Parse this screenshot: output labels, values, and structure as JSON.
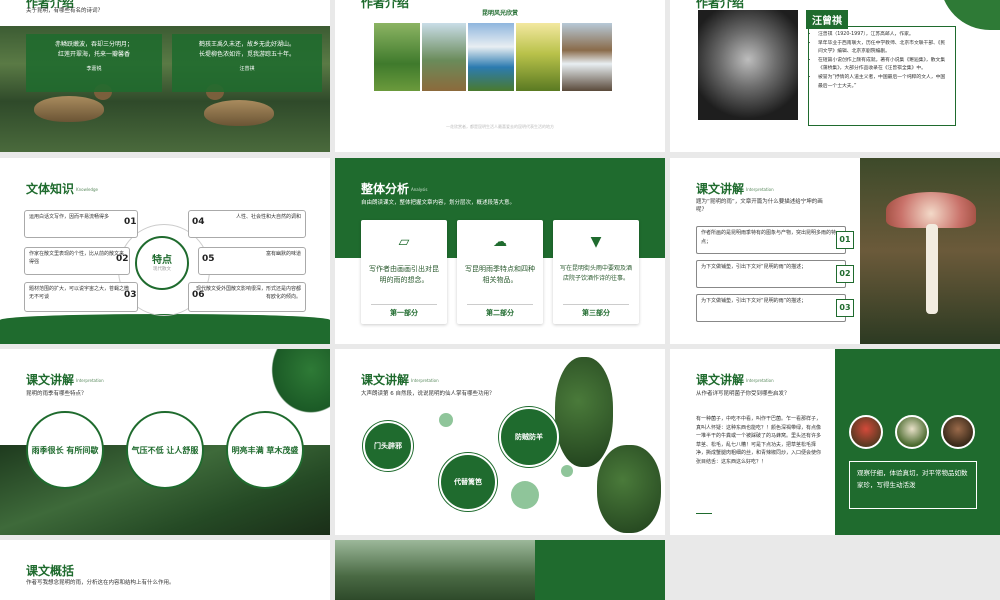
{
  "slide1": {
    "title": "作者介绍",
    "subtitle": "关于昆明，有哪些有名的诗词？",
    "quote_left": {
      "line1": "赤鳞跃嫩波，吞却三分明月；",
      "line2": "红莲开翠海，托来一瓣馨香",
      "author": "李嘉锐"
    },
    "quote_right": {
      "line1": "鹤孩王禹久未还，故乡无此好湖山。",
      "line2": "长堤柳色浓如许，觅我游踪五十年。",
      "author": "汪曾祺"
    }
  },
  "slide2": {
    "title": "作者介绍",
    "gallery_title": "昆明风光欣赏",
    "caption": "一花欣赏者，都是昆明生活人最喜爱去的昆明代表生活的地方"
  },
  "slide3": {
    "title": "作者介绍",
    "name": "汪曾祺",
    "bio": [
      "汪曾祺（1920-1997），江苏高邮人，作家。",
      "早年毕业于西南联大，历任中学教师、北京市文联干部、《民间文学》编辑、北京京剧院编剧。",
      "在短篇小说创作上颇有成就。著有小说集《邂逅集》，散文集《蒲桥集》，大部分作品收录在《汪曾祺全集》中。",
      "被誉为“抒情的人道主义者，中国最后一个纯粹的文人，中国最后一个士大夫。”"
    ]
  },
  "slide4": {
    "title": "文体知识",
    "title_en": "Knowledge",
    "center_label": "特点",
    "center_sub": "现代散文",
    "items": [
      {
        "num": "01",
        "text": "运用白话文写作，因而平易流畅得多"
      },
      {
        "num": "02",
        "text": "作家在散文里表现的个性，比从前的散文来得强"
      },
      {
        "num": "03",
        "text": "题材范围的扩大，可以说宇宙之大，苍蝇之微无不可谈"
      },
      {
        "num": "04",
        "text": "人性、社会性和大自然的调和"
      },
      {
        "num": "05",
        "text": "富有幽默的味道"
      },
      {
        "num": "06",
        "text": "现代散文受外国散文影响很深，形式还是内容都有欧化的倾向。"
      }
    ]
  },
  "slide5": {
    "title": "整体分析",
    "title_en": "Analysis",
    "subtitle": "自由朗读课文，整体把握文章内容，划分层次，概述段落大意。",
    "cards": [
      {
        "text": "写作者由画画引出对昆明的雨的想念。",
        "foot": "第一部分",
        "icon": "easel-icon"
      },
      {
        "text": "写昆明雨季特点和四种相关物品。",
        "foot": "第二部分",
        "icon": "rain-cloud-icon"
      },
      {
        "text": "写在昆明街头雨中要观及酒店院子饮酒作诗的往事。",
        "foot": "第三部分",
        "icon": "cocktail-icon"
      }
    ]
  },
  "slide6": {
    "title": "课文讲解",
    "title_en": "Interpretation",
    "subtitle": "题为“昆明的雨”，文章开篇为什么要描述给宁坤的画呢？",
    "rows": [
      {
        "num": "01",
        "text": "作者所画的是昆明雨季特有的图象与产物，突出昆明多雨的特点；"
      },
      {
        "num": "02",
        "text": "为下文做铺垫，引出下文对“昆明的雨”的描述；"
      },
      {
        "num": "03",
        "text": "为下文做铺垫，引出下文对“昆明的雨”的描述；"
      }
    ]
  },
  "slide7": {
    "title": "课文讲解",
    "title_en": "Interpretation",
    "subtitle": "昆明的雨季有哪些特点？",
    "circles": [
      "雨季很长 有所间歇",
      "气压不低 让人舒服",
      "明亮丰满 草木茂盛"
    ]
  },
  "slide8": {
    "title": "课文讲解",
    "title_en": "Interpretation",
    "subtitle": "大声朗读第 6 自然段，说说昆明的仙人掌有哪些功用？",
    "dots": [
      "门头辟邪",
      "代替篱笆",
      "防贼防羊"
    ]
  },
  "slide9": {
    "title": "课文讲解",
    "title_en": "Interpretation",
    "subtitle": "从作者详写昆明菌子你受到哪些启发？",
    "body": "有一种菌子，中吃不中看，叫作干巴菌。乍一看那样子，真叫人怀疑：这种东西也能吃？！颜色深褐带绿，有点像一堆半干的牛粪或一个被踩破了的马蜂窝。里头还有许多草茎、松毛，乱七八糟！可是下点功夫，把草茎松毛择净，撕成蟹腿肉粗细的丝，和青辣椒同炒，入口便会使你张目结舌：这东西这么好吃？！",
    "box_text": "观察仔细，体验真切，对平常物品如数家珍，写得生动活泼"
  },
  "slide10": {
    "title": "课文概括",
    "subtitle": "作者写我想念昆明的雨，分析这在内容和结构上有什么作用。"
  },
  "colors": {
    "brand": "#1f6b2e",
    "light": "#8fc59a"
  }
}
